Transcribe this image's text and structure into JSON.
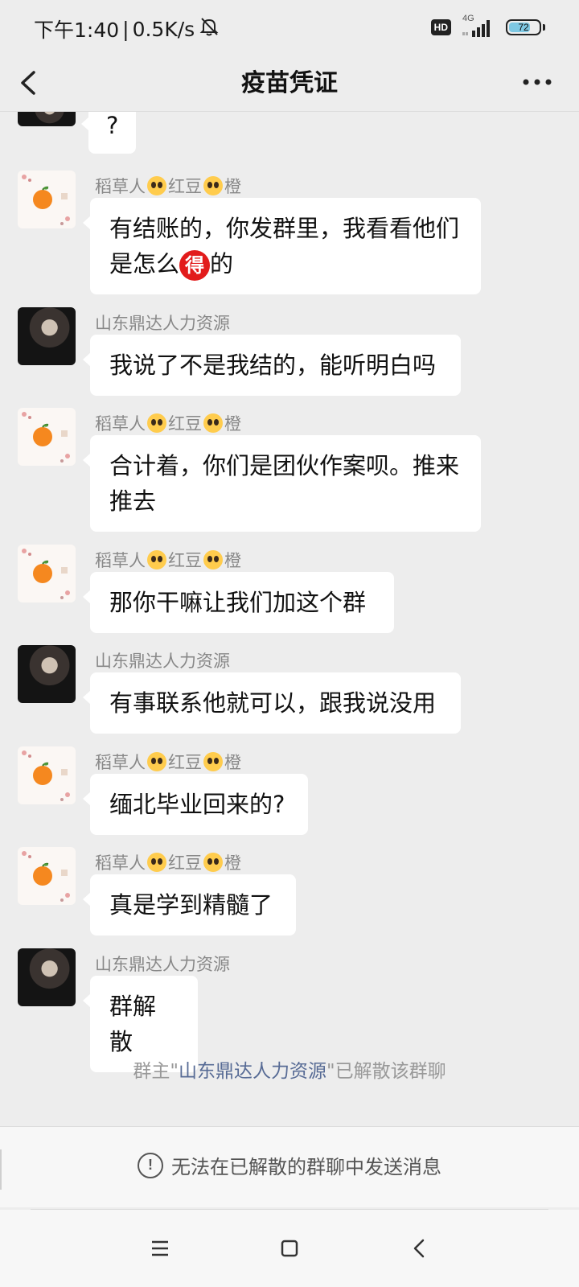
{
  "status_bar": {
    "time": "下午1:40",
    "separator": "|",
    "speed": "0.5K/s",
    "hd_label": "HD",
    "network": "4G",
    "battery": "72",
    "battery_level": 0.72,
    "icons": [
      "mute-bell-icon",
      "signal-icon",
      "battery-icon"
    ]
  },
  "header": {
    "title": "疫苗凭证"
  },
  "chat": {
    "partial_message": {
      "text": "?"
    },
    "messages": [
      {
        "sender": {
          "prefix": "稻草人",
          "mid": "红豆",
          "suffix": "橙"
        },
        "avatar": "orange",
        "lines": [
          "有结账的，你发群里，我看看他们",
          "是怎么",
          "得",
          "的"
        ]
      },
      {
        "sender_text": "山东鼎达人力资源",
        "avatar": "dark",
        "lines": [
          "我说了不是我结的，能听明白吗"
        ]
      },
      {
        "sender": {
          "prefix": "稻草人",
          "mid": "红豆",
          "suffix": "橙"
        },
        "avatar": "orange",
        "lines": [
          "合计着，你们是团伙作案呗。推来",
          "推去"
        ]
      },
      {
        "sender": {
          "prefix": "稻草人",
          "mid": "红豆",
          "suffix": "橙"
        },
        "avatar": "orange",
        "lines": [
          "那你干嘛让我们加这个群"
        ]
      },
      {
        "sender_text": "山东鼎达人力资源",
        "avatar": "dark",
        "lines": [
          "有事联系他就可以，跟我说没用"
        ]
      },
      {
        "sender": {
          "prefix": "稻草人",
          "mid": "红豆",
          "suffix": "橙"
        },
        "avatar": "orange",
        "lines": [
          "缅北毕业回来的?"
        ]
      },
      {
        "sender": {
          "prefix": "稻草人",
          "mid": "红豆",
          "suffix": "橙"
        },
        "avatar": "orange",
        "lines": [
          "真是学到精髓了"
        ]
      },
      {
        "sender_text": "山东鼎达人力资源",
        "avatar": "dark",
        "lines": [
          "群解散"
        ]
      }
    ]
  },
  "system_notice": {
    "prefix": "群主\"",
    "owner": "山东鼎达人力资源",
    "suffix": "\"已解散该群聊"
  },
  "bottom_notice": {
    "icon": "!",
    "text": "无法在已解散的群聊中发送消息"
  },
  "colors": {
    "background": "#ededed",
    "bubble": "#ffffff",
    "owner_link": "#576b95",
    "badge_red": "#e21b1b"
  }
}
